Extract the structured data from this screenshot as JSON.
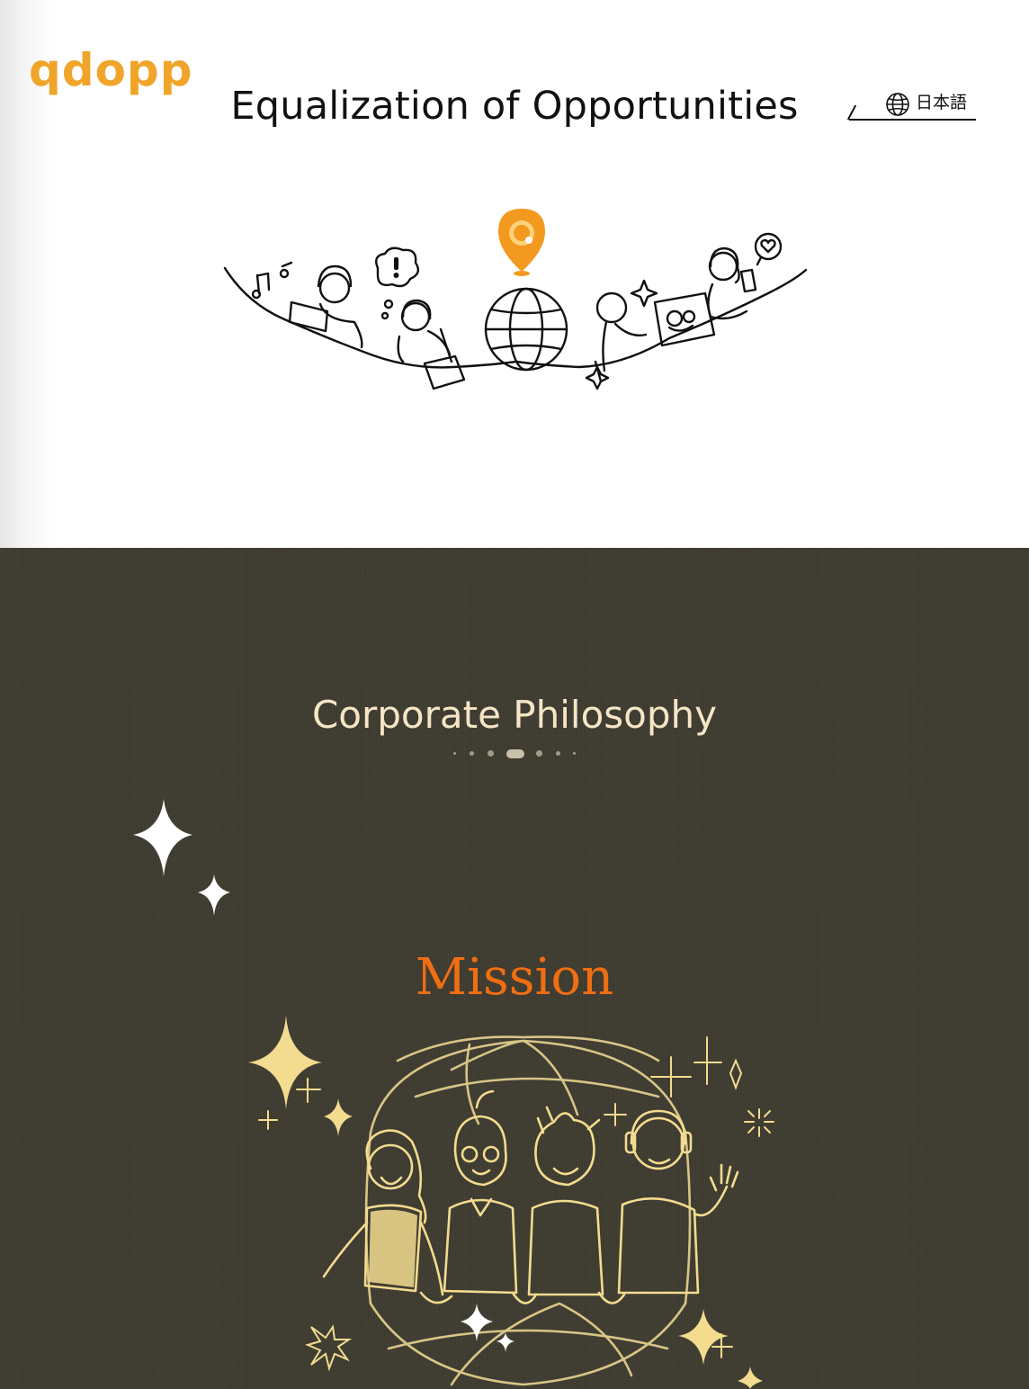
{
  "brand": {
    "logo_text": "qdopp",
    "logo_color": "#f0a52a"
  },
  "hero": {
    "tagline": "Equalization of Opportunities",
    "illustration": "people-around-globe-illustration",
    "pin_color": "#f29a1f"
  },
  "language_switch": {
    "icon": "globe-icon",
    "label": "日本語"
  },
  "philosophy": {
    "title": "Corporate Philosophy",
    "title_color": "#f5e6c6",
    "pagination_active_index": 3,
    "pagination_count": 7,
    "background_color": "#3f3c31"
  },
  "mission": {
    "title": "Mission",
    "title_color": "#f06e12",
    "illustration": "friends-holding-hands-globe-illustration",
    "line_color": "#f3dc8f"
  }
}
